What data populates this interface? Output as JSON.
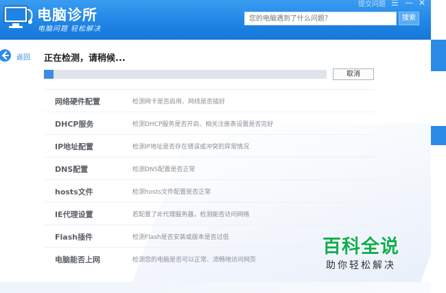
{
  "app": {
    "title": "电脑诊所",
    "subtitle": "电脑问题 轻松解决",
    "search_placeholder": "您的电脑遇到了什么问题？",
    "search_button": "搜索",
    "top_link": "提交问题"
  },
  "nav": {
    "back_label": "返回"
  },
  "status": {
    "title": "正在检测，请稍候...",
    "progress": 0.035,
    "cancel_label": "取消"
  },
  "checks": [
    {
      "name": "网络硬件配置",
      "desc": "检测网卡是否启用、网线是否插好"
    },
    {
      "name": "DHCP服务",
      "desc": "检测DHCP服务是否开启、相关注册表设置是否完好"
    },
    {
      "name": "IP地址配置",
      "desc": "检测IP地址是否存在错误或冲突的异常情况"
    },
    {
      "name": "DNS配置",
      "desc": "检测DNS配置是否正常"
    },
    {
      "name": "hosts文件",
      "desc": "检测hosts文件配置是否正常"
    },
    {
      "name": "IE代理设置",
      "desc": "若配置了IE代理服务器，检测能否访问网络"
    },
    {
      "name": "Flash插件",
      "desc": "检测Flash是否安装或版本是否过低"
    },
    {
      "name": "电脑能否上网",
      "desc": "检测您的电脑是否可以正常、流畅地访问网页"
    }
  ],
  "watermark": {
    "main": "百科全说",
    "sub": "助你轻松解决"
  },
  "colors": {
    "accent": "#1f84e4",
    "progress": "#3d8be3",
    "watermark": "#0fae4f"
  }
}
